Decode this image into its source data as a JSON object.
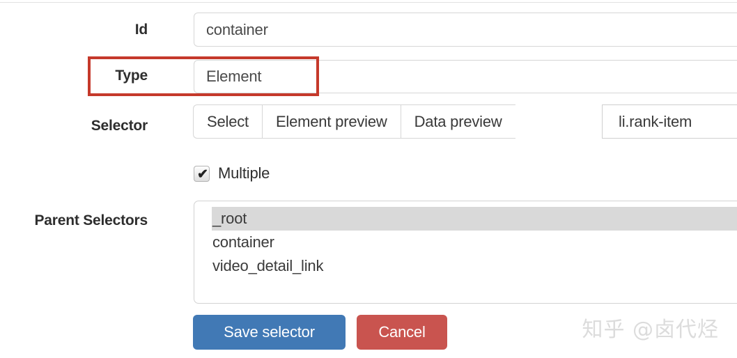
{
  "form": {
    "id_row": {
      "label": "Id",
      "value": "container"
    },
    "type_row": {
      "label": "Type",
      "value": "Element"
    },
    "selector_row": {
      "label": "Selector",
      "buttons": [
        {
          "label": "Select"
        },
        {
          "label": "Element preview"
        },
        {
          "label": "Data preview"
        }
      ],
      "selector_value": "li.rank-item"
    },
    "multiple_row": {
      "label": "Multiple",
      "checked": true,
      "check_glyph": "✔"
    },
    "parent_selectors_row": {
      "label": "Parent Selectors",
      "options": [
        {
          "label": "_root",
          "selected": true
        },
        {
          "label": "container",
          "selected": false
        },
        {
          "label": "video_detail_link",
          "selected": false
        }
      ]
    }
  },
  "actions": {
    "save_label": "Save selector",
    "cancel_label": "Cancel"
  },
  "annotation": {
    "highlight_color": "#c5392b"
  },
  "watermark": {
    "text": "知乎 @卤代烃"
  },
  "colors": {
    "save_button": "#4179b5",
    "cancel_button": "#c9544f",
    "selected_row": "#d9d9d9",
    "field_border": "#d6d6d6"
  }
}
